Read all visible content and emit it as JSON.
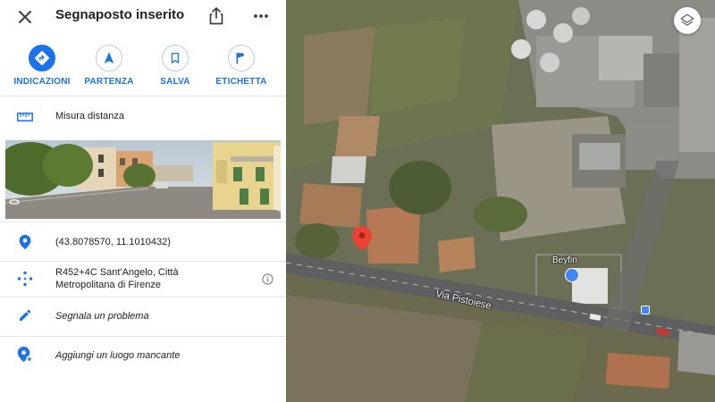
{
  "header": {
    "title": "Segnaposto inserito"
  },
  "actions": [
    {
      "label": "INDICAZIONI",
      "icon": "directions-icon"
    },
    {
      "label": "PARTENZA",
      "icon": "navigation-arrow-icon"
    },
    {
      "label": "SALVA",
      "icon": "bookmark-icon"
    },
    {
      "label": "ETICHETTA",
      "icon": "flag-icon"
    }
  ],
  "measure": {
    "label": "Misura distanza",
    "icon": "ruler-icon"
  },
  "details": {
    "coordinates": "(43.8078570, 11.1010432)",
    "plus_code_line1": "R452+4C Sant'Angelo, Città",
    "plus_code_line2": "Metropolitana di Firenze",
    "report": "Segnala un problema",
    "add_place": "Aggiungi un luogo mancante"
  },
  "map": {
    "road_name": "Via Pistoiese",
    "poi_name": "Beyfin"
  },
  "colors": {
    "accent": "#1a73e8",
    "pin_red": "#ea4335",
    "text": "#202124"
  }
}
